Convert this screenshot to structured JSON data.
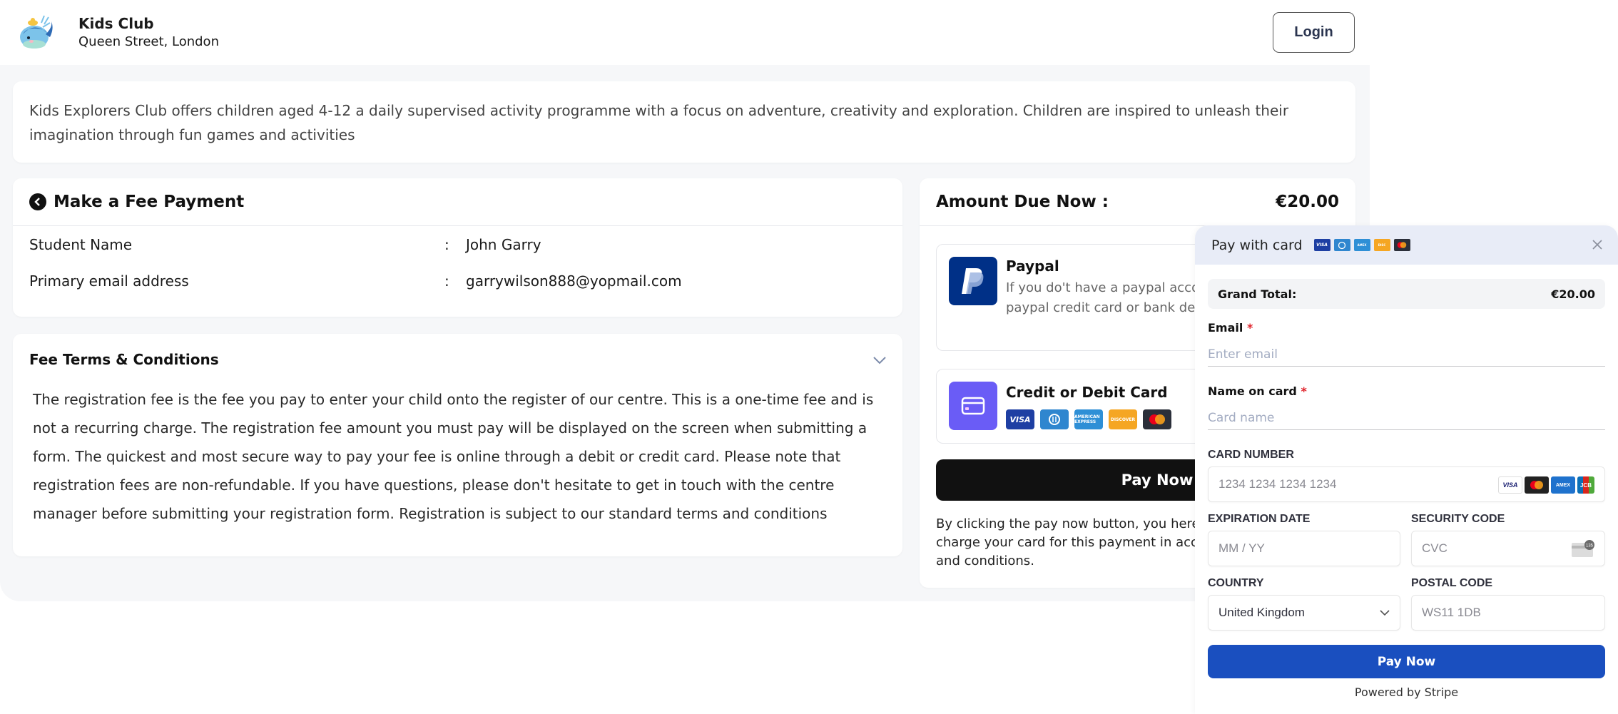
{
  "header": {
    "brand_name": "Kids Club",
    "brand_location": "Queen Street, London",
    "login_label": "Login"
  },
  "description": "Kids Explorers Club offers children aged 4-12 a daily supervised activity programme with a focus on adventure, creativity and exploration. Children are inspired to unleash their imagination through fun games and activities",
  "payment_info": {
    "title": "Make a Fee Payment",
    "rows": [
      {
        "label": "Student Name",
        "separator": ":",
        "value": "John Garry"
      },
      {
        "label": "Primary email address",
        "separator": ":",
        "value": "garrywilson888@yopmail.com"
      }
    ]
  },
  "terms": {
    "title": "Fee Terms & Conditions",
    "body": "The registration fee is the fee you pay to enter your child onto the register of our centre. This is a one-time fee and is not a recurring charge. The registration fee amount you must pay will be displayed on the screen when submitting a form. The quickest and most secure way to pay your fee is online through a debit or credit card. Please note that registration fees are non-refundable. If you have questions, please don't hesitate to get in touch with the centre manager before submitting your registration form. Registration is subject to our standard terms and conditions"
  },
  "amount": {
    "label": "Amount Due Now :",
    "value": "€20.00",
    "methods": [
      {
        "title": "Paypal",
        "description": "If you do't have a paypal account, you can also pay via paypal credit card or bank debit card option."
      },
      {
        "title": "Credit or Debit Card",
        "card_brands": [
          "VISA",
          "Diners Club",
          "American Express",
          "Discover",
          "Mastercard"
        ]
      }
    ],
    "pay_button": "Pay Now",
    "disclaimer": "By clicking the pay now button, you hereby authorize us to charge your card for this payment in accordance with our terms and conditions."
  },
  "stripe": {
    "title": "Pay with card",
    "header_brands": [
      "VISA",
      "Diners Club",
      "American Express",
      "Discover",
      "Mastercard"
    ],
    "grand_total_label": "Grand Total:",
    "grand_total_value": "€20.00",
    "email_label": "Email",
    "email_placeholder": "Enter email",
    "name_label": "Name on card",
    "name_placeholder": "Card name",
    "required_mark": "*",
    "card_number_label": "CARD NUMBER",
    "card_number_placeholder": "1234 1234 1234 1234",
    "card_number_brands": [
      "VISA",
      "Mastercard",
      "Amex",
      "JCB"
    ],
    "expiry_label": "EXPIRATION DATE",
    "expiry_placeholder": "MM / YY",
    "cvc_label": "SECURITY CODE",
    "cvc_placeholder": "CVC",
    "cvc_hint": "135",
    "country_label": "COUNTRY",
    "country_value": "United Kingdom",
    "postal_label": "POSTAL CODE",
    "postal_placeholder": "WS11 1DB",
    "pay_button": "Pay Now",
    "powered_by": "Powered by Stripe"
  },
  "colors": {
    "page_bg": "#f6f7f9",
    "paypal_blue": "#003087",
    "card_purple": "#6a5cf6",
    "stripe_pay_blue": "#1a4fbf",
    "stripe_header_bg": "#e8ecf7",
    "required_red": "#e0242c"
  }
}
